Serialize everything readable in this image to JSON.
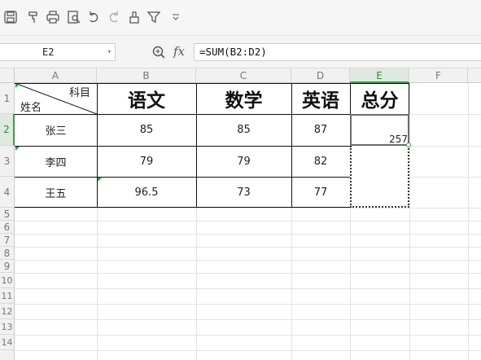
{
  "toolbar": {
    "icons": [
      "save-icon",
      "format-painter-icon",
      "print-icon",
      "print-preview-icon",
      "undo-icon",
      "redo-icon",
      "clear-icon",
      "filter-icon",
      "more-dropdown-icon"
    ]
  },
  "formula_bar": {
    "name_box": "E2",
    "fx_label": "fx",
    "formula": "=SUM(B2:D2)"
  },
  "sheet": {
    "columns": [
      "A",
      "B",
      "C",
      "D",
      "E",
      "F"
    ],
    "active_column": "E",
    "rows": [
      "1",
      "2",
      "3",
      "4",
      "5",
      "6",
      "7",
      "8",
      "9",
      "10",
      "11",
      "12",
      "13",
      "14"
    ],
    "active_row": "2",
    "header_row": {
      "a_top_right": "科目",
      "a_bottom_left": "姓名",
      "b": "语文",
      "c": "数学",
      "d": "英语",
      "e": "总分"
    },
    "data": [
      {
        "name": "张三",
        "chinese": "85",
        "math": "85",
        "english": "87",
        "total": "257"
      },
      {
        "name": "李四",
        "chinese": "79",
        "math": "79",
        "english": "82",
        "total": ""
      },
      {
        "name": "王五",
        "chinese": "96.5",
        "math": "73",
        "english": "77",
        "total": ""
      }
    ]
  },
  "colors": {
    "active_accent": "#3c9a4a",
    "comment_marker": "#2e9b3c"
  }
}
